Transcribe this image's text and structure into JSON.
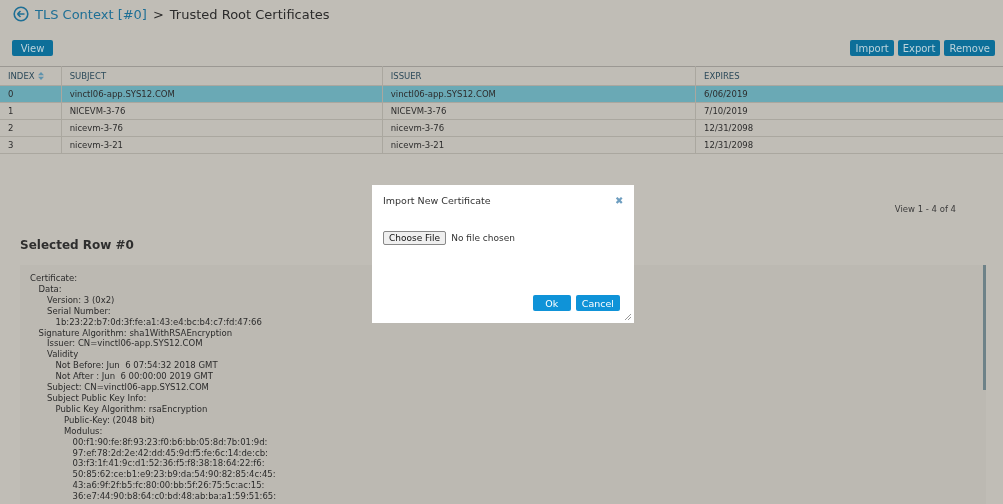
{
  "header": {
    "back_link": "TLS Context [#0]",
    "separator": ">",
    "title": "Trusted Root Certificates"
  },
  "toolbar": {
    "left": [
      "View"
    ],
    "right": [
      "Import",
      "Export",
      "Remove"
    ]
  },
  "table": {
    "columns": [
      {
        "label": "INDEX",
        "sorted": true
      },
      {
        "label": "SUBJECT",
        "sorted": false
      },
      {
        "label": "ISSUER",
        "sorted": false
      },
      {
        "label": "EXPIRES",
        "sorted": false
      }
    ],
    "rows": [
      {
        "selected": true,
        "cells": [
          "0",
          "vinctl06-app.SYS12.COM",
          "vinctl06-app.SYS12.COM",
          "6/06/2019"
        ]
      },
      {
        "selected": false,
        "cells": [
          "1",
          "NICEVM-3-76",
          "NICEVM-3-76",
          "7/10/2019"
        ]
      },
      {
        "selected": false,
        "cells": [
          "2",
          "nicevm-3-76",
          "nicevm-3-76",
          "12/31/2098"
        ]
      },
      {
        "selected": false,
        "cells": [
          "3",
          "nicevm-3-21",
          "nicevm-3-21",
          "12/31/2098"
        ]
      }
    ]
  },
  "pager": "View 1 - 4 of 4",
  "details": {
    "title": "Selected Row #0",
    "lines": [
      {
        "text": "Certificate:",
        "children": [
          {
            "text": "Data:",
            "children": [
              {
                "text": "Version: 3 (0x2)"
              },
              {
                "text": "Serial Number:",
                "children": [
                  {
                    "text": "1b:23:22:b7:0d:3f:fe:a1:43:e4:bc:b4:c7:fd:47:66"
                  }
                ]
              }
            ]
          },
          {
            "text": "Signature Algorithm: sha1WithRSAEncryption",
            "children": [
              {
                "text": "Issuer: CN=vinctl06-app.SYS12.COM"
              },
              {
                "text": "Validity",
                "children": [
                  {
                    "text": "Not Before: Jun  6 07:54:32 2018 GMT"
                  },
                  {
                    "text": "Not After : Jun  6 00:00:00 2019 GMT"
                  }
                ]
              },
              {
                "text": "Subject: CN=vinctl06-app.SYS12.COM"
              },
              {
                "text": "Subject Public Key Info:",
                "children": [
                  {
                    "text": "Public Key Algorithm: rsaEncryption",
                    "children": [
                      {
                        "text": "Public-Key: (2048 bit)"
                      },
                      {
                        "text": "Modulus:",
                        "children": [
                          {
                            "text": "00:f1:90:fe:8f:93:23:f0:b6:bb:05:8d:7b:01:9d:"
                          },
                          {
                            "text": "97:ef:78:2d:2e:42:dd:45:9d:f5:fe:6c:14:de:cb:"
                          },
                          {
                            "text": "03:f3:1f:41:9c:d1:52:36:f5:f8:38:18:64:22:f6:"
                          },
                          {
                            "text": "50:85:62:ce:b1:e9:23:b9:da:54:90:82:85:4c:45:"
                          },
                          {
                            "text": "43:a6:9f:2f:b5:fc:80:00:bb:5f:26:75:5c:ac:15:"
                          },
                          {
                            "text": "36:e7:44:90:b8:64:c0:bd:48:ab:ba:a1:59:51:65:"
                          }
                        ]
                      }
                    ]
                  }
                ]
              }
            ]
          }
        ]
      }
    ]
  },
  "dialog": {
    "title": "Import New Certificate",
    "close": "✖",
    "file_button": "Choose File",
    "file_status": "No file chosen",
    "buttons": [
      "Ok",
      "Cancel"
    ]
  }
}
